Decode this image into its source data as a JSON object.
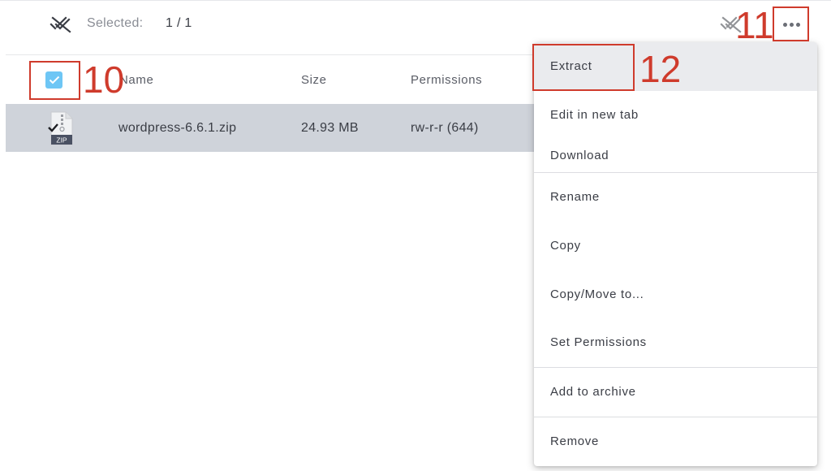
{
  "selection_bar": {
    "label": "Selected:",
    "count": "1 / 1",
    "deselect_icon": "remove-done-icon",
    "more_icon": "more-horizontal-icon"
  },
  "table": {
    "columns": [
      "Name",
      "Size",
      "Permissions"
    ],
    "rows": [
      {
        "name": "wordpress-6.6.1.zip",
        "size": "24.93 MB",
        "permissions": "rw-r-r (644)",
        "icon_badge": "ZIP",
        "selected": true
      }
    ]
  },
  "menu": {
    "items": [
      {
        "label": "Extract"
      },
      {
        "label": "Edit in new tab"
      },
      {
        "label": "Download"
      },
      {
        "label": "Rename"
      },
      {
        "label": "Copy"
      },
      {
        "label": "Copy/Move to..."
      },
      {
        "label": "Set Permissions"
      },
      {
        "label": "Add to archive"
      },
      {
        "label": "Remove"
      }
    ]
  },
  "annotations": [
    "10",
    "11",
    "12"
  ],
  "colors": {
    "accent": "#6ec6f5",
    "annotation": "#cf3b2c",
    "row_selected": "#cfd3da"
  }
}
